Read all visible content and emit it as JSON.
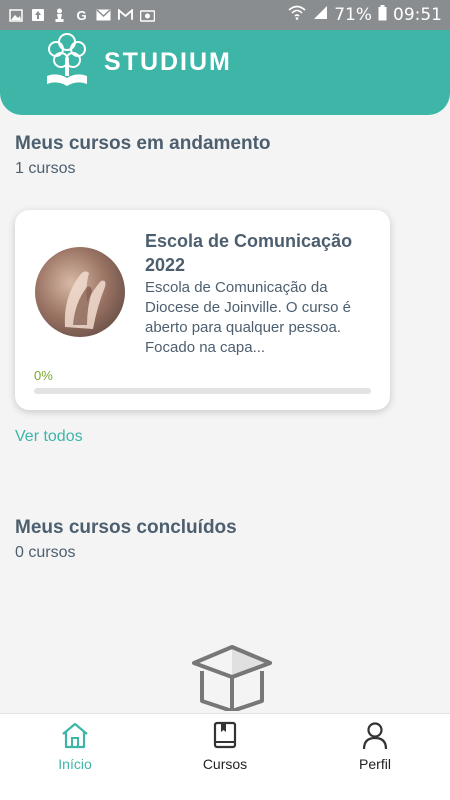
{
  "status_bar": {
    "battery_percent": "71%",
    "time": "09:51",
    "left_icons": [
      "image-icon",
      "upload-icon",
      "chess-icon",
      "google-icon",
      "email-icon",
      "gmail-icon",
      "photo-icon"
    ],
    "right_icons": [
      "wifi-icon",
      "signal-icon",
      "battery-icon"
    ]
  },
  "header": {
    "brand": "STUDIUM",
    "background_color": "#3db6a8"
  },
  "in_progress": {
    "title": "Meus cursos em andamento",
    "count": "1 cursos",
    "courses": [
      {
        "title": "Escola de Comunicação 2022",
        "description": "Escola de Comunicação da Diocese de Joinville. O curso é aberto para qualquer pessoa. Focado na capa...",
        "progress_label": "0%",
        "progress_fraction": 0
      }
    ],
    "see_all": "Ver todos"
  },
  "completed": {
    "title": "Meus cursos concluídos",
    "count": "0 cursos"
  },
  "bottom_nav": {
    "items": [
      {
        "label": "Início",
        "icon": "home-icon",
        "active": true
      },
      {
        "label": "Cursos",
        "icon": "book-icon",
        "active": false
      },
      {
        "label": "Perfil",
        "icon": "user-icon",
        "active": false
      }
    ],
    "active_color": "#3db6a8"
  },
  "colors": {
    "accent": "#3db6a8",
    "progress": "#7aa82a",
    "text": "#4d5f6f"
  }
}
